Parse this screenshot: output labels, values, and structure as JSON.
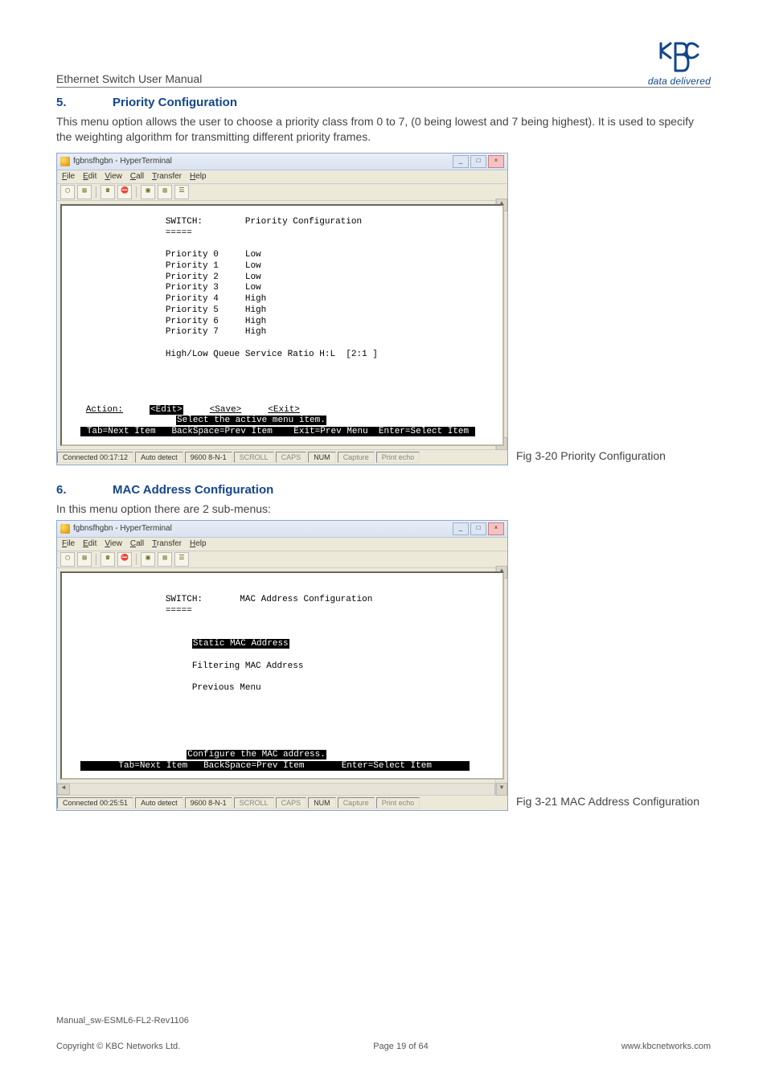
{
  "header": {
    "title": "Ethernet Switch User Manual",
    "logo_caption": "data delivered",
    "logo_letters": "KBC"
  },
  "section5": {
    "num": "5.",
    "title": "Priority Configuration",
    "body": "This menu option allows the user to choose a priority class from 0 to 7, (0 being lowest and 7 being highest). It is used to specify the weighting algorithm for transmitting different priority frames.",
    "fig": "Fig 3-20 Priority Configuration"
  },
  "section6": {
    "num": "6.",
    "title": "MAC Address Configuration",
    "intro": "In this menu option there are 2 sub-menus:",
    "fig": "Fig 3-21 MAC Address Configuration"
  },
  "term_common": {
    "window_title": "fgbnsfhgbn - HyperTerminal",
    "menu": [
      "File",
      "Edit",
      "View",
      "Call",
      "Transfer",
      "Help"
    ],
    "win_min": "_",
    "win_max": "□",
    "win_close": "×"
  },
  "term1": {
    "status": {
      "time": "Connected 00:17:12",
      "detect": "Auto detect",
      "conn": "9600 8-N-1",
      "scroll": "SCROLL",
      "caps": "CAPS",
      "num": "NUM",
      "capture": "Capture",
      "echo": "Print echo"
    },
    "switch_label": "SWITCH:",
    "switch_eq": "=====",
    "screen_title": "Priority Configuration",
    "rows": [
      {
        "label": "Priority 0",
        "value": "Low"
      },
      {
        "label": "Priority 1",
        "value": "Low"
      },
      {
        "label": "Priority 2",
        "value": "Low"
      },
      {
        "label": "Priority 3",
        "value": "Low"
      },
      {
        "label": "Priority 4",
        "value": "High"
      },
      {
        "label": "Priority 5",
        "value": "High"
      },
      {
        "label": "Priority 6",
        "value": "High"
      },
      {
        "label": "Priority 7",
        "value": "High"
      }
    ],
    "ratio": "High/Low Queue Service Ratio H:L  [2:1 ]",
    "action_label": "Action:",
    "action_edit": "<Edit>",
    "action_save": "<Save>",
    "action_exit": "<Exit>",
    "action_hint": "Select the active menu item.",
    "footer": {
      "tab": "Tab=Next Item",
      "back": "BackSpace=Prev Item",
      "exit": "Exit=Prev Menu",
      "enter": "Enter=Select Item"
    }
  },
  "term2": {
    "status": {
      "time": "Connected 00:25:51",
      "detect": "Auto detect",
      "conn": "9600 8-N-1",
      "scroll": "SCROLL",
      "caps": "CAPS",
      "num": "NUM",
      "capture": "Capture",
      "echo": "Print echo"
    },
    "switch_label": "SWITCH:",
    "switch_eq": "=====",
    "screen_title": "MAC Address Configuration",
    "opt1": "Static MAC Address",
    "opt2": "Filtering MAC Address",
    "opt3": "Previous Menu",
    "hint": "Configure the MAC address.",
    "footer": {
      "tab": "Tab=Next Item",
      "back": "BackSpace=Prev Item",
      "enter": "Enter=Select Item"
    }
  },
  "footer": {
    "manual": "Manual_sw-ESML6-FL2-Rev1106",
    "copyright": "Copyright © KBC Networks Ltd.",
    "page": "Page 19 of 64",
    "url": "www.kbcnetworks.com"
  }
}
